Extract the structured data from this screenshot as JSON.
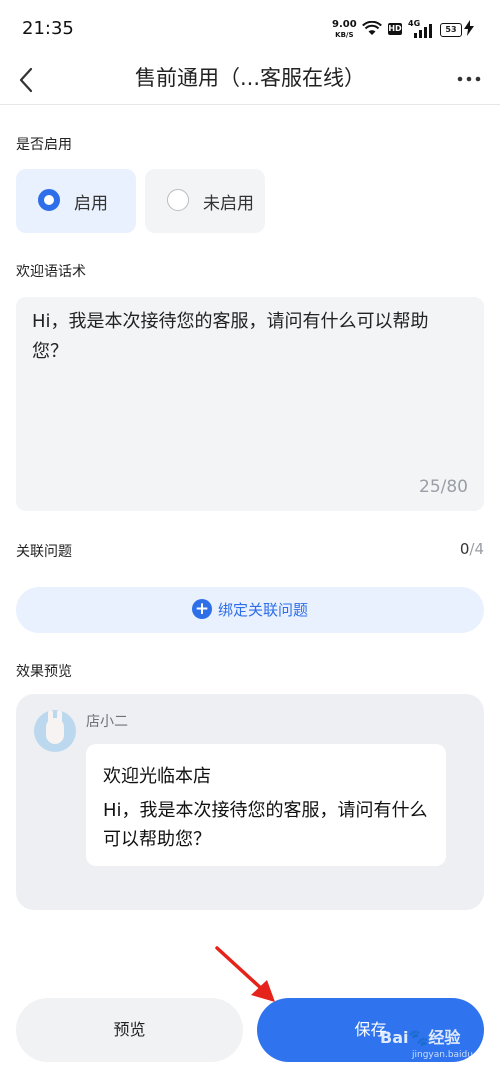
{
  "status_bar": {
    "time": "21:35",
    "net_speed": "9.00",
    "net_unit": "KB/S",
    "hd": "HD",
    "signal": "4G",
    "battery": "53"
  },
  "nav": {
    "title": "售前通用（...客服在线）",
    "back_icon": "chevron-left-icon",
    "more_icon": "more-icon"
  },
  "enable": {
    "label": "是否启用",
    "options": [
      {
        "label": "启用",
        "selected": true
      },
      {
        "label": "未启用",
        "selected": false
      }
    ]
  },
  "welcome": {
    "label": "欢迎语话术",
    "text": "Hi，我是本次接待您的客服，请问有什么可以帮助您？",
    "count": "25/80"
  },
  "related": {
    "label": "关联问题",
    "count_current": "0",
    "count_total": "/4",
    "bind_button": "绑定关联问题"
  },
  "preview": {
    "label": "效果预览",
    "shop_name": "店小二",
    "bubble_title": "欢迎光临本店",
    "bubble_text": "Hi，我是本次接待您的客服，请问有什么可以帮助您？"
  },
  "actions": {
    "preview_button": "预览",
    "save_button": "保存"
  },
  "watermark": {
    "text": "Bai🐾经验",
    "sub": "jingyan.baidu.com"
  },
  "colors": {
    "accent": "#2e6ee8",
    "annotation": "#e5231b"
  }
}
